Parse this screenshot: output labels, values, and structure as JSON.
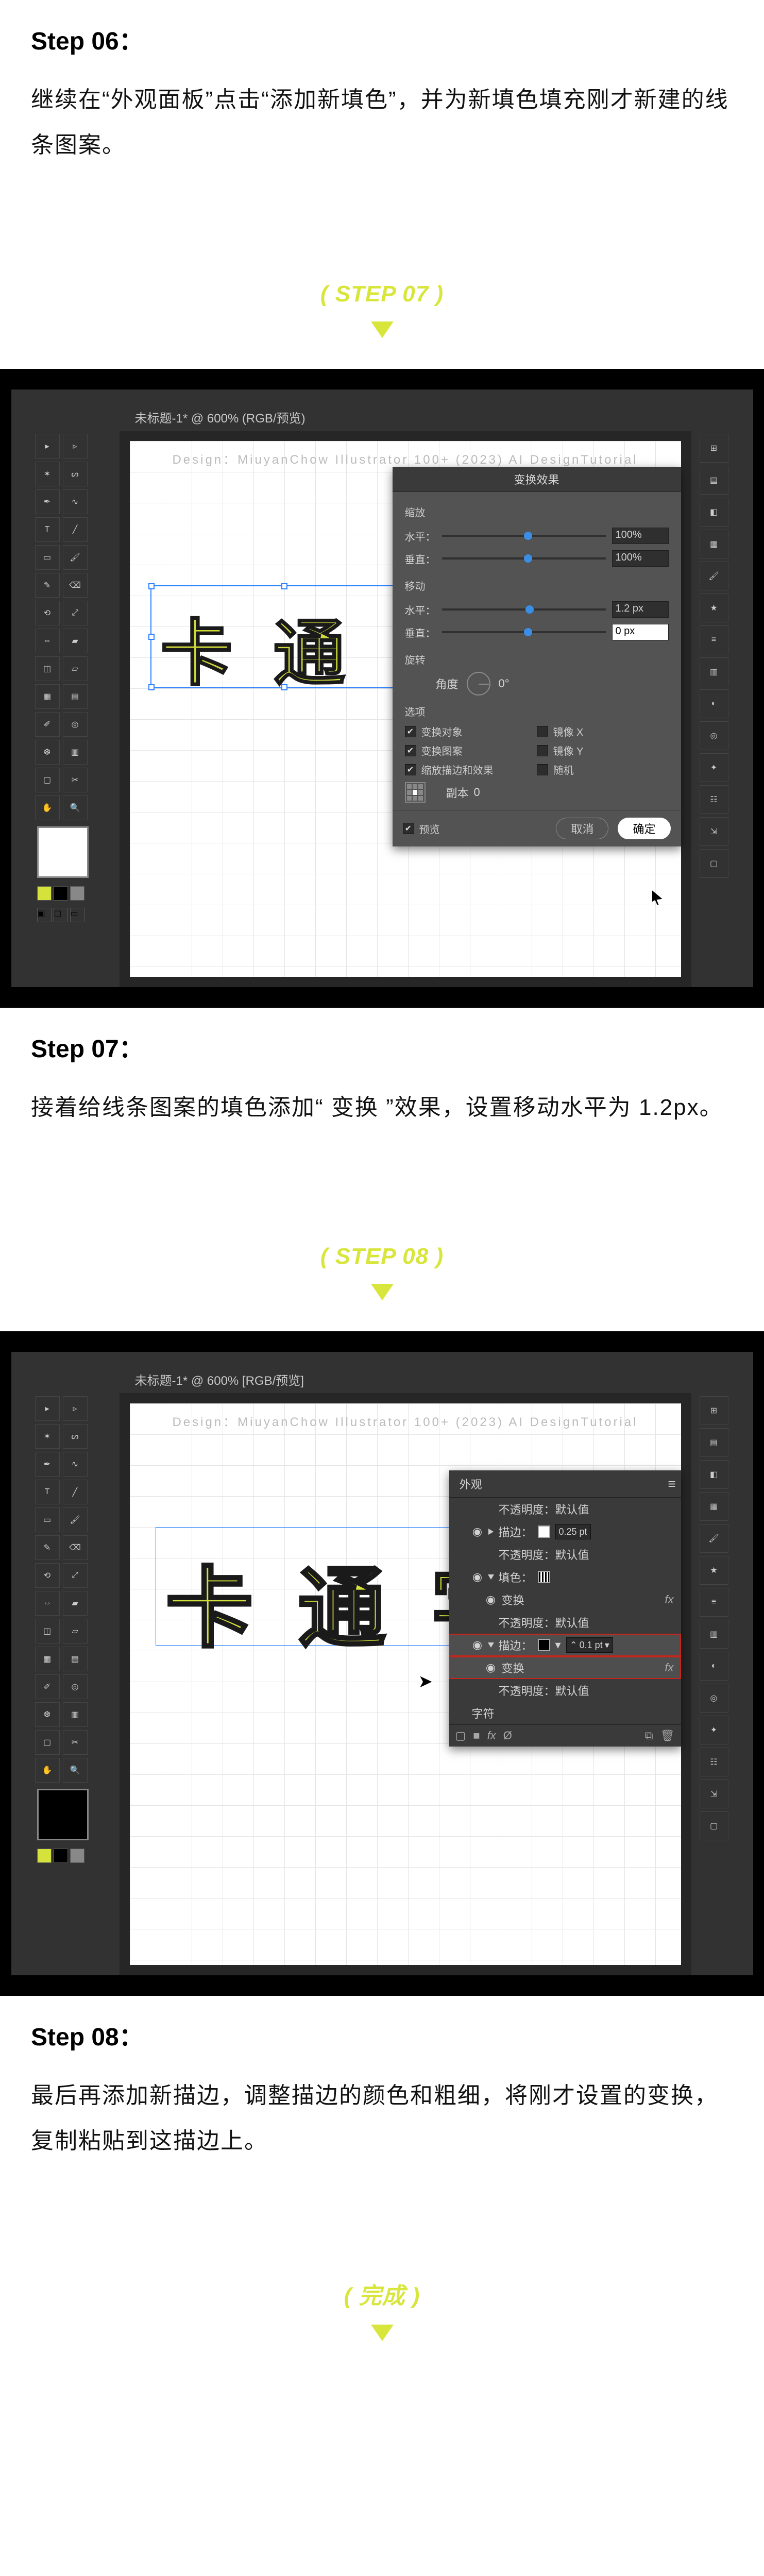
{
  "step06": {
    "title": "Step 06：",
    "desc": "继续在“外观面板”点击“添加新填色”，并为新填色填充刚才新建的线条图案。"
  },
  "divider07": {
    "label": "( STEP 07 )"
  },
  "shot07": {
    "tab": "未标题-1* @ 600% (RGB/预览)",
    "watermark": "Design：MiuyanChow        Illustrator 100+        (2023)        AI DesignTutorial",
    "canvas_text": "卡 通",
    "dialog": {
      "title": "变换效果",
      "scale_label": "缩放",
      "hor_label": "水平：",
      "ver_label": "垂直：",
      "hor_value": "100%",
      "ver_value": "100%",
      "move_label": "移动",
      "move_hor": "1.2 px",
      "move_ver": "0 px",
      "rotate_label": "旋转",
      "angle_label": "角度",
      "angle_value": "0°",
      "options_label": "选项",
      "opt_transform_object": "变换对象",
      "opt_transform_pattern": "变换图案",
      "opt_scale_stroke": "缩放描边和效果",
      "opt_reflect_x": "镜像 X",
      "opt_reflect_y": "镜像 Y",
      "opt_random": "随机",
      "copies_label": "副本",
      "copies_value": "0",
      "preview": "预览",
      "cancel": "取消",
      "ok": "确定"
    }
  },
  "step07": {
    "title": "Step 07：",
    "desc": "接着给线条图案的填色添加“ 变换 ”效果，设置移动水平为 1.2px。"
  },
  "divider08": {
    "label": "( STEP 08 )"
  },
  "shot08": {
    "tab": "未标题-1* @ 600% [RGB/预览]",
    "watermark": "Design：MiuyanChow        Illustrator 100+        (2023)        AI DesignTutorial",
    "canvas_text": "卡 通 字",
    "appearance": {
      "tab": "外观",
      "row_op_default1": "不透明度：默认值",
      "row_stroke1_label": "描边：",
      "row_stroke1_value": "0.25 pt",
      "row_op_default2": "不透明度：默认值",
      "row_fill_label": "填色：",
      "row_transform1": "变换",
      "row_op_default3": "不透明度：默认值",
      "row_stroke2_label": "描边：",
      "row_stroke2_value": "0.1 pt",
      "row_transform2": "变换",
      "row_op_default4": "不透明度：默认值",
      "row_char": "字符"
    }
  },
  "step08": {
    "title": "Step 08：",
    "desc": "最后再添加新描边，调整描边的颜色和粗细，将刚才设置的变换，复制粘贴到这描边上。"
  },
  "dividerEnd": {
    "label": "( 完成 )"
  }
}
